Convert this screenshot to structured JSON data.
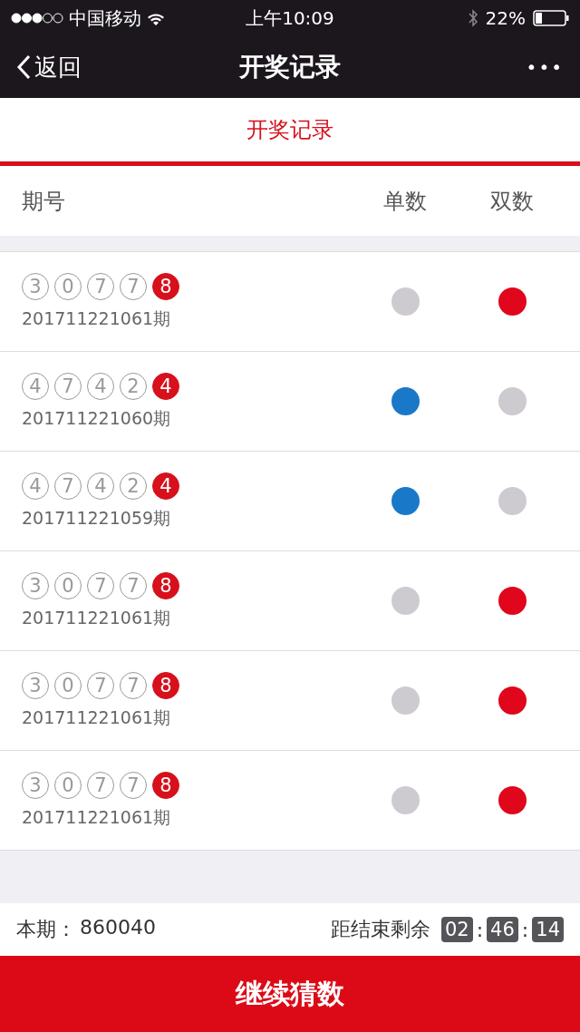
{
  "status_bar": {
    "carrier": "中国移动",
    "time": "上午10:09",
    "battery": "22%"
  },
  "nav_bar": {
    "back": "返回",
    "title": "开奖记录",
    "more": "•••"
  },
  "tabs": [
    {
      "label": "开奖记录",
      "selected": true
    }
  ],
  "table": {
    "columns": [
      "期号",
      "单数",
      "双数"
    ],
    "rows": [
      {
        "balls": [
          {
            "digit": "3",
            "highlighted": false
          },
          {
            "digit": "0",
            "highlighted": false
          },
          {
            "digit": "7",
            "highlighted": false
          },
          {
            "digit": "7",
            "highlighted": false
          },
          {
            "digit": "8",
            "highlighted": true
          }
        ],
        "issue": "201711221061期",
        "odd_on": false,
        "even_on": true
      },
      {
        "balls": [
          {
            "digit": "4",
            "highlighted": false
          },
          {
            "digit": "7",
            "highlighted": false
          },
          {
            "digit": "4",
            "highlighted": false
          },
          {
            "digit": "2",
            "highlighted": false
          },
          {
            "digit": "4",
            "highlighted": true
          }
        ],
        "issue": "201711221060期",
        "odd_on": true,
        "even_on": false
      },
      {
        "balls": [
          {
            "digit": "4",
            "highlighted": false
          },
          {
            "digit": "7",
            "highlighted": false
          },
          {
            "digit": "4",
            "highlighted": false
          },
          {
            "digit": "2",
            "highlighted": false
          },
          {
            "digit": "4",
            "highlighted": true
          }
        ],
        "issue": "201711221059期",
        "odd_on": true,
        "even_on": false
      },
      {
        "balls": [
          {
            "digit": "3",
            "highlighted": false
          },
          {
            "digit": "0",
            "highlighted": false
          },
          {
            "digit": "7",
            "highlighted": false
          },
          {
            "digit": "7",
            "highlighted": false
          },
          {
            "digit": "8",
            "highlighted": true
          }
        ],
        "issue": "201711221061期",
        "odd_on": false,
        "even_on": true
      },
      {
        "balls": [
          {
            "digit": "3",
            "highlighted": false
          },
          {
            "digit": "0",
            "highlighted": false
          },
          {
            "digit": "7",
            "highlighted": false
          },
          {
            "digit": "7",
            "highlighted": false
          },
          {
            "digit": "8",
            "highlighted": true
          }
        ],
        "issue": "201711221061期",
        "odd_on": false,
        "even_on": true
      },
      {
        "balls": [
          {
            "digit": "3",
            "highlighted": false
          },
          {
            "digit": "0",
            "highlighted": false
          },
          {
            "digit": "7",
            "highlighted": false
          },
          {
            "digit": "7",
            "highlighted": false
          },
          {
            "digit": "8",
            "highlighted": true
          }
        ],
        "issue": "201711221061期",
        "odd_on": false,
        "even_on": true
      }
    ]
  },
  "footer": {
    "current_label": "本期：",
    "current_value": "860040",
    "countdown_label": "距结束剩余",
    "countdown": [
      "02",
      "46",
      "14"
    ],
    "separator": ":"
  },
  "action_button": "继续猜数"
}
